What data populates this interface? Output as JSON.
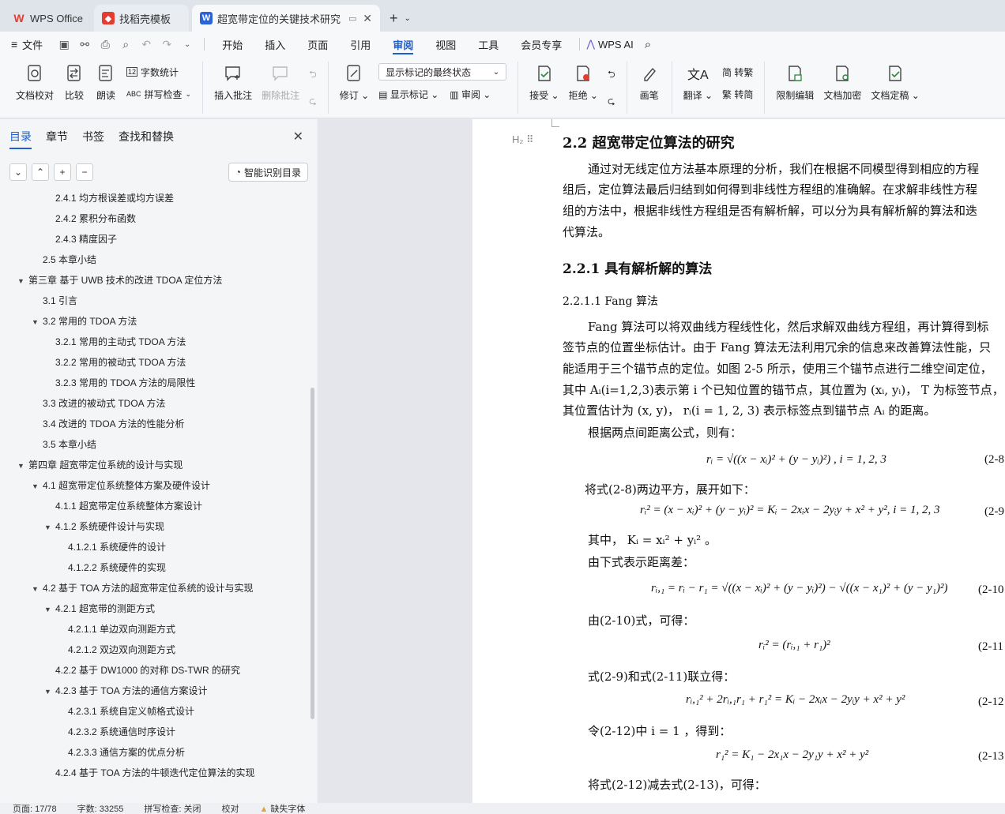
{
  "tabs": [
    {
      "label": "WPS Office",
      "icon": "wps-logo-icon"
    },
    {
      "label": "找稻壳模板",
      "icon": "docer-logo-icon"
    },
    {
      "label": "超宽带定位的关键技术研究 毕",
      "icon": "writer-logo-icon"
    }
  ],
  "menu": {
    "file": "文件",
    "items": [
      "开始",
      "插入",
      "页面",
      "引用",
      "审阅",
      "视图",
      "工具",
      "会员专享"
    ],
    "active": "审阅",
    "ai": "WPS AI"
  },
  "ribbon": {
    "doc_check": "文档校对",
    "compare": "比较",
    "read_aloud": "朗读",
    "word_count": "字数统计",
    "spell_check": "拼写检查",
    "insert_comment": "插入批注",
    "delete_comment": "删除批注",
    "track": "修订",
    "markup_select": "显示标记的最终状态",
    "show_markup": "显示标记",
    "review": "审阅",
    "accept": "接受",
    "reject": "拒绝",
    "pen": "画笔",
    "translate": "翻译",
    "to_traditional": "简 转繁",
    "to_simplified": "繁 转简",
    "restrict_edit": "限制编辑",
    "encrypt": "文档加密",
    "finalize": "文档定稿"
  },
  "sidebar": {
    "tabs": [
      "目录",
      "章节",
      "书签",
      "查找和替换"
    ],
    "active_tab": "目录",
    "smart_button": "智能识别目录",
    "toc": [
      {
        "label": "2.4.1  均方根误差或均方误差",
        "level": 3,
        "arrow": ""
      },
      {
        "label": "2.4.2  累积分布函数",
        "level": 3,
        "arrow": ""
      },
      {
        "label": "2.4.3  精度因子",
        "level": 3,
        "arrow": ""
      },
      {
        "label": "2.5  本章小结",
        "level": 2,
        "arrow": ""
      },
      {
        "label": "第三章  基于 UWB 技术的改进 TDOA 定位方法",
        "level": 1,
        "arrow": "▼"
      },
      {
        "label": "3.1  引言",
        "level": 2,
        "arrow": ""
      },
      {
        "label": "3.2  常用的 TDOA 方法",
        "level": 2,
        "arrow": "▼"
      },
      {
        "label": "3.2.1 常用的主动式 TDOA 方法",
        "level": 3,
        "arrow": ""
      },
      {
        "label": "3.2.2 常用的被动式 TDOA 方法",
        "level": 3,
        "arrow": ""
      },
      {
        "label": "3.2.3  常用的 TDOA 方法的局限性",
        "level": 3,
        "arrow": ""
      },
      {
        "label": "3.3  改进的被动式 TDOA 方法",
        "level": 2,
        "arrow": ""
      },
      {
        "label": "3.4  改进的 TDOA 方法的性能分析",
        "level": 2,
        "arrow": ""
      },
      {
        "label": "3.5  本章小结",
        "level": 2,
        "arrow": ""
      },
      {
        "label": "第四章  超宽带定位系统的设计与实现",
        "level": 1,
        "arrow": "▼"
      },
      {
        "label": "4.1  超宽带定位系统整体方案及硬件设计",
        "level": 2,
        "arrow": "▼"
      },
      {
        "label": "4.1.1  超宽带定位系统整体方案设计",
        "level": 3,
        "arrow": ""
      },
      {
        "label": "4.1.2  系统硬件设计与实现",
        "level": 3,
        "arrow": "▼"
      },
      {
        "label": "4.1.2.1  系统硬件的设计",
        "level": 4,
        "arrow": ""
      },
      {
        "label": "4.1.2.2  系统硬件的实现",
        "level": 4,
        "arrow": ""
      },
      {
        "label": "4.2  基于 TOA 方法的超宽带定位系统的设计与实现",
        "level": 2,
        "arrow": "▼"
      },
      {
        "label": "4.2.1  超宽带的测距方式",
        "level": 3,
        "arrow": "▼"
      },
      {
        "label": "4.2.1.1  单边双向测距方式",
        "level": 4,
        "arrow": ""
      },
      {
        "label": "4.2.1.2  双边双向测距方式",
        "level": 4,
        "arrow": ""
      },
      {
        "label": "4.2.2  基于 DW1000 的对称 DS-TWR 的研究",
        "level": 3,
        "arrow": ""
      },
      {
        "label": "4.2.3  基于 TOA 方法的通信方案设计",
        "level": 3,
        "arrow": "▼"
      },
      {
        "label": "4.2.3.1  系统自定义帧格式设计",
        "level": 4,
        "arrow": ""
      },
      {
        "label": "4.2.3.2  系统通信时序设计",
        "level": 4,
        "arrow": ""
      },
      {
        "label": "4.2.3.3  通信方案的优点分析",
        "level": 4,
        "arrow": ""
      },
      {
        "label": "4.2.4  基于 TOA 方法的牛顿迭代定位算法的实现",
        "level": 3,
        "arrow": ""
      }
    ]
  },
  "doc": {
    "heading_mark": "H₂ ⠿",
    "h2": "2.2  超宽带定位算法的研究",
    "p1": [
      "通过对无线定位方法基本原理的分析，我们在根据不同模型得到相应的方程",
      "组后，定位算法最后归结到如何得到非线性方程组的准确解。在求解非线性方程",
      "组的方法中，根据非线性方程组是否有解析解，可以分为具有解析解的算法和迭",
      "代算法。"
    ],
    "h3": "2.2.1  具有解析解的算法",
    "h4": "2.2.1.1 Fang 算法",
    "p2": [
      "Fang 算法可以将双曲线方程线性化，然后求解双曲线方程组，再计算得到标",
      "签节点的位置坐标估计。由于 Fang 算法无法利用冗余的信息来改善算法性能，只",
      "能适用于三个锚节点的定位。如图 2-5 所示，使用三个锚节点进行二维空间定位，",
      "其中 Aᵢ(i=1,2,3)表示第 i 个已知位置的锚节点，其位置为 (xᵢ, yᵢ)， T 为标签节点，",
      "其位置估计为 (x, y)， rᵢ(i = 1, 2, 3) 表示标签点到锚节点 Aᵢ 的距离。"
    ],
    "p3": "根据两点间距离公式，则有：",
    "eq8": "rᵢ = √((x − xᵢ)² + (y − yᵢ)²) , i = 1, 2, 3",
    "eq8_no": "(2-8",
    "p4": "将式(2-8)两边平方，展开如下：",
    "eq9": "rᵢ² = (x − xᵢ)² + (y − yᵢ)² = Kᵢ − 2xᵢx − 2yᵢy + x² + y², i = 1, 2, 3",
    "eq9_no": "(2-9",
    "p5": "其中， Kᵢ = xᵢ² + yᵢ² 。",
    "p6": "由下式表示距离差：",
    "eq10": "rᵢ,₁ = rᵢ − r₁ = √((x − xᵢ)² + (y − yᵢ)²) − √((x − x₁)² + (y − y₁)²)",
    "eq10_no": "(2-10",
    "p7": "由(2-10)式，可得：",
    "eq11": "rᵢ² = (rᵢ,₁ + r₁)²",
    "eq11_no": "(2-11",
    "p8": "式(2-9)和式(2-11)联立得：",
    "eq12": "rᵢ,₁² + 2rᵢ,₁r₁ + r₁² = Kᵢ − 2xᵢx − 2yᵢy + x² + y²",
    "eq12_no": "(2-12",
    "p9": "令(2-12)中 i = 1 ，得到：",
    "eq13": "r₁² = K₁ − 2x₁x − 2y₁y + x² + y²",
    "eq13_no": "(2-13",
    "p10": "将式(2-12)减去式(2-13)，可得："
  },
  "status": {
    "page": "页面: 17/78",
    "words": "字数: 33255",
    "spell": "拼写检查: 关闭",
    "proof": "校对",
    "missing_font": "缺失字体"
  },
  "colors": {
    "accent": "#1a5fd6",
    "wps_red": "#e43d30"
  }
}
